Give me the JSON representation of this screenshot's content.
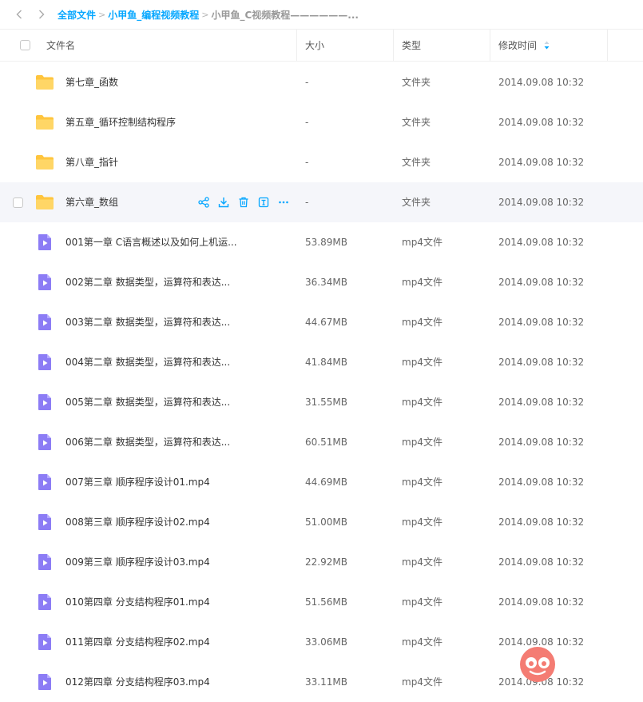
{
  "breadcrumb": {
    "items": [
      "全部文件",
      "小甲鱼_编程视频教程"
    ],
    "current": "小甲鱼_C视频教程——————..."
  },
  "header": {
    "name": "文件名",
    "size": "大小",
    "type": "类型",
    "modified": "修改时间"
  },
  "files": [
    {
      "name": "第七章_函数",
      "size": "-",
      "type": "文件夹",
      "date": "2014.09.08 10:32",
      "kind": "folder"
    },
    {
      "name": "第五章_循环控制结构程序",
      "size": "-",
      "type": "文件夹",
      "date": "2014.09.08 10:32",
      "kind": "folder"
    },
    {
      "name": "第八章_指针",
      "size": "-",
      "type": "文件夹",
      "date": "2014.09.08 10:32",
      "kind": "folder"
    },
    {
      "name": "第六章_数组",
      "size": "-",
      "type": "文件夹",
      "date": "2014.09.08 10:32",
      "kind": "folder",
      "hover": true
    },
    {
      "name": "001第一章 C语言概述以及如何上机运...",
      "size": "53.89MB",
      "type": "mp4文件",
      "date": "2014.09.08 10:32",
      "kind": "video"
    },
    {
      "name": "002第二章 数据类型，运算符和表达...",
      "size": "36.34MB",
      "type": "mp4文件",
      "date": "2014.09.08 10:32",
      "kind": "video"
    },
    {
      "name": "003第二章 数据类型，运算符和表达...",
      "size": "44.67MB",
      "type": "mp4文件",
      "date": "2014.09.08 10:32",
      "kind": "video"
    },
    {
      "name": "004第二章 数据类型，运算符和表达...",
      "size": "41.84MB",
      "type": "mp4文件",
      "date": "2014.09.08 10:32",
      "kind": "video"
    },
    {
      "name": "005第二章 数据类型，运算符和表达...",
      "size": "31.55MB",
      "type": "mp4文件",
      "date": "2014.09.08 10:32",
      "kind": "video"
    },
    {
      "name": "006第二章 数据类型，运算符和表达...",
      "size": "60.51MB",
      "type": "mp4文件",
      "date": "2014.09.08 10:32",
      "kind": "video"
    },
    {
      "name": "007第三章 顺序程序设计01.mp4",
      "size": "44.69MB",
      "type": "mp4文件",
      "date": "2014.09.08 10:32",
      "kind": "video"
    },
    {
      "name": "008第三章 顺序程序设计02.mp4",
      "size": "51.00MB",
      "type": "mp4文件",
      "date": "2014.09.08 10:32",
      "kind": "video"
    },
    {
      "name": "009第三章 顺序程序设计03.mp4",
      "size": "22.92MB",
      "type": "mp4文件",
      "date": "2014.09.08 10:32",
      "kind": "video"
    },
    {
      "name": "010第四章 分支结构程序01.mp4",
      "size": "51.56MB",
      "type": "mp4文件",
      "date": "2014.09.08 10:32",
      "kind": "video"
    },
    {
      "name": "011第四章 分支结构程序02.mp4",
      "size": "33.06MB",
      "type": "mp4文件",
      "date": "2014.09.08 10:32",
      "kind": "video"
    },
    {
      "name": "012第四章 分支结构程序03.mp4",
      "size": "33.11MB",
      "type": "mp4文件",
      "date": "2014.09.08 10:32",
      "kind": "video"
    }
  ],
  "row_actions": [
    "share-icon",
    "download-icon",
    "delete-icon",
    "rename-icon",
    "more-icon"
  ],
  "colors": {
    "accent": "#06a7ff",
    "folder": "#ffc53d",
    "video": "#8c7cf5",
    "hover_bg": "#f5f6fa"
  }
}
